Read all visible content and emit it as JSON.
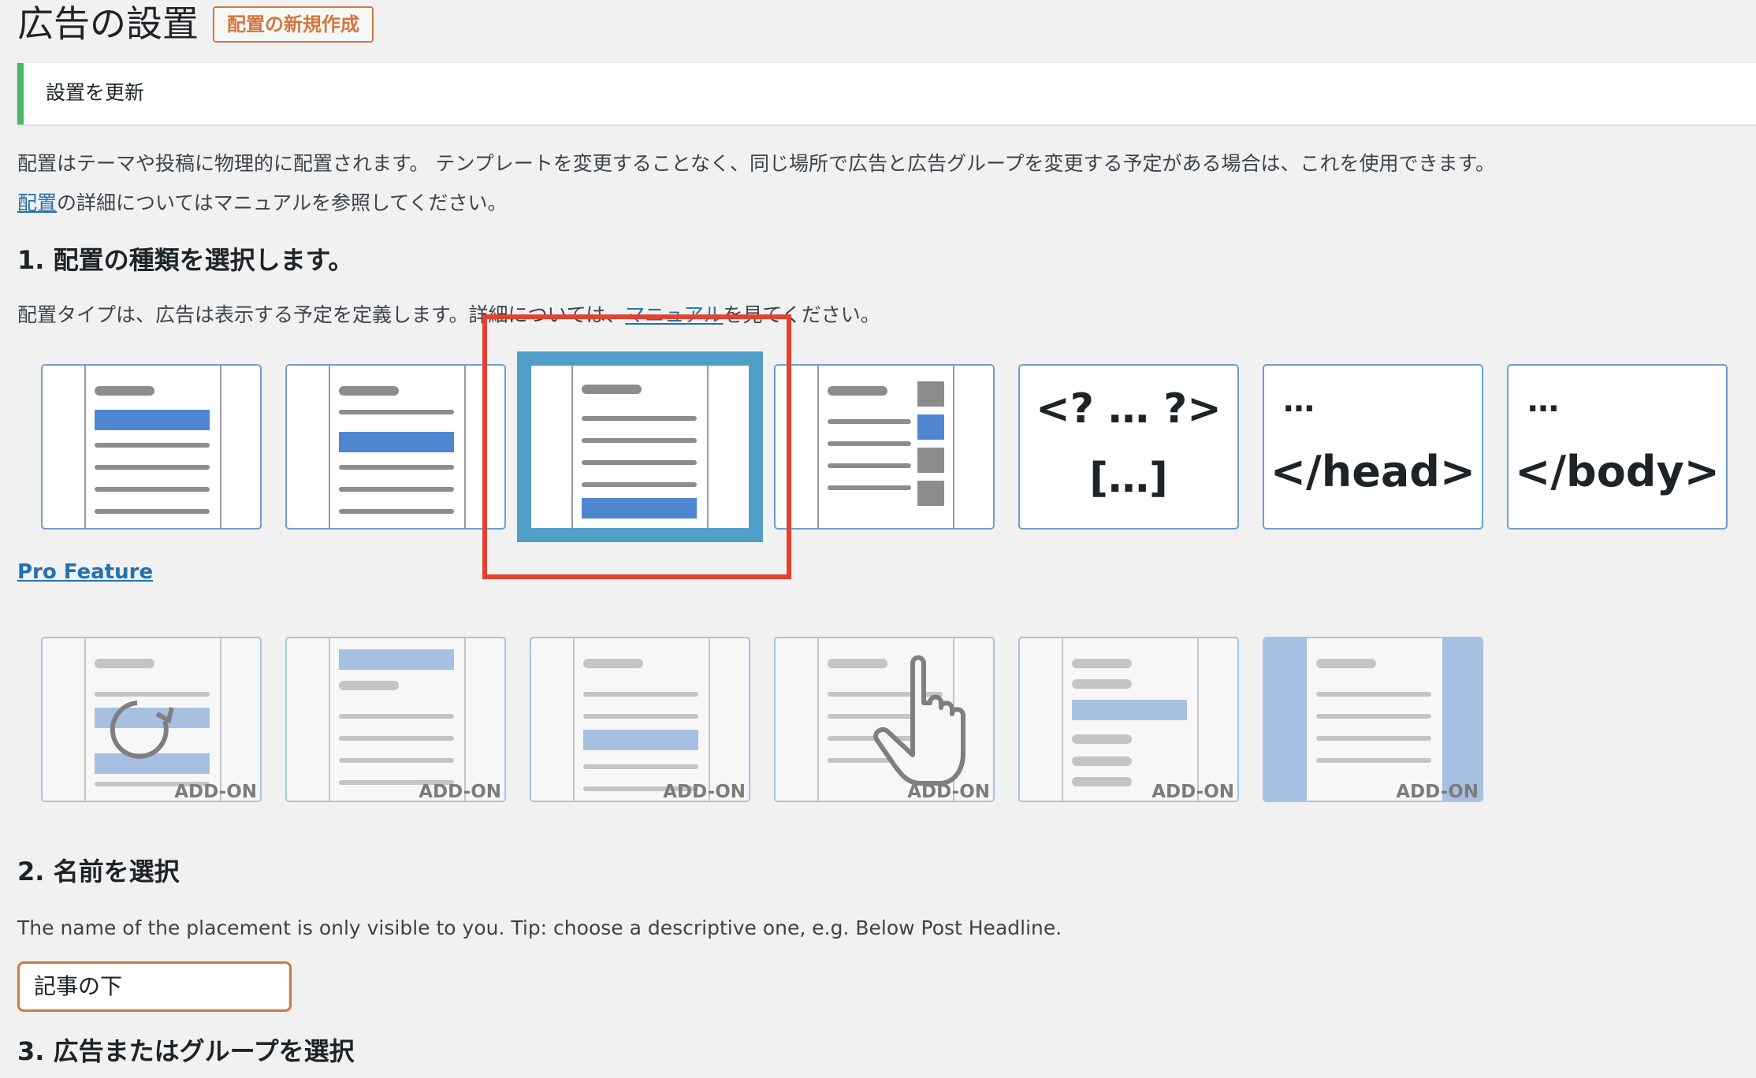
{
  "page": {
    "title": "広告の設置",
    "add_new_label": "配置の新規作成"
  },
  "notice": {
    "text": "設置を更新"
  },
  "intro": {
    "line1": "配置はテーマや投稿に物理的に配置されます。 テンプレートを変更することなく、同じ場所で広告と広告グループを変更する予定がある場合は、これを使用できます。",
    "line2_link": "配置",
    "line2_rest": "の詳細についてはマニュアルを参照してください。"
  },
  "step1": {
    "heading": "1. 配置の種類を選択します。",
    "desc_before": "配置タイプは、広告は表示する予定を定義します。詳細については、",
    "desc_link": "マニュアル",
    "desc_after": "を見てください。",
    "code_labels": {
      "php_line1": "<? … ?>",
      "php_line2": "[…]",
      "head_line1": "…",
      "head_line2": "</head>",
      "body_line1": "…",
      "body_line2": "</body>"
    },
    "selected_index": 2,
    "pro_feature_label": "Pro Feature",
    "addon_label": "ADD-ON"
  },
  "step2": {
    "heading": "2. 名前を選択",
    "desc": "The name of the placement is only visible to you. Tip: choose a descriptive one, e.g. Below Post Headline.",
    "input_value": "記事の下"
  },
  "step3": {
    "heading": "3. 広告またはグループを選択"
  },
  "colors": {
    "accent_orange": "#d5763d",
    "link_blue": "#2271b1",
    "notice_green": "#4ab866",
    "selected_blue": "#4f9fc8",
    "highlight_red": "#e4412f",
    "ad_block_blue": "#4f86cf",
    "addon_block_blue": "#a7c0e2"
  }
}
